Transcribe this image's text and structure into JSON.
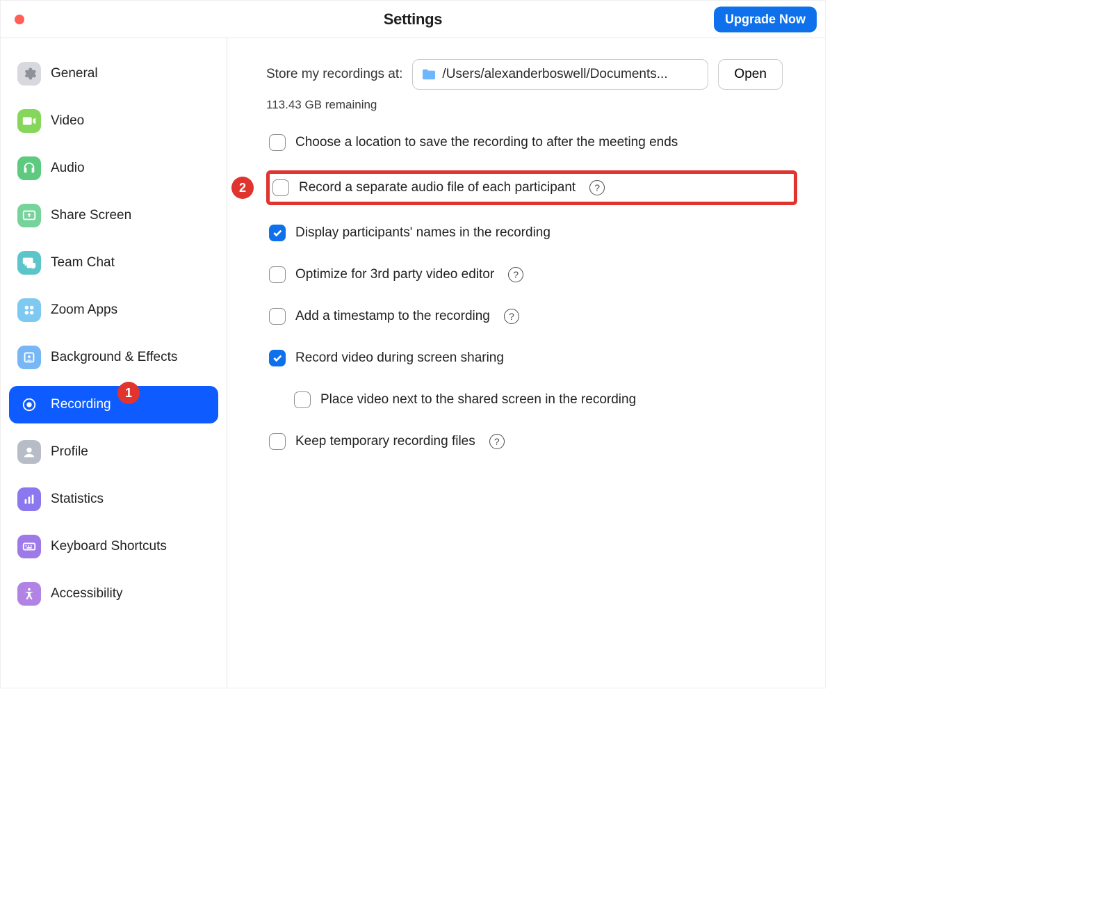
{
  "window": {
    "title": "Settings",
    "upgrade_label": "Upgrade Now"
  },
  "sidebar": {
    "items": [
      {
        "label": "General",
        "icon": "gear-icon",
        "color": "#d7d9de",
        "fg": "#8e9199"
      },
      {
        "label": "Video",
        "icon": "video-icon",
        "color": "#86d65b",
        "fg": "#ffffff"
      },
      {
        "label": "Audio",
        "icon": "headphones-icon",
        "color": "#5eca7f",
        "fg": "#ffffff"
      },
      {
        "label": "Share Screen",
        "icon": "share-screen-icon",
        "color": "#76d39a",
        "fg": "#ffffff"
      },
      {
        "label": "Team Chat",
        "icon": "chat-icon",
        "color": "#5cc5c9",
        "fg": "#ffffff"
      },
      {
        "label": "Zoom Apps",
        "icon": "apps-icon",
        "color": "#7ec9f2",
        "fg": "#ffffff"
      },
      {
        "label": "Background & Effects",
        "icon": "background-icon",
        "color": "#78b7f6",
        "fg": "#ffffff"
      },
      {
        "label": "Recording",
        "icon": "record-icon",
        "color": "#ffffff",
        "fg": "#0e5cff",
        "active": true
      },
      {
        "label": "Profile",
        "icon": "profile-icon",
        "color": "#b7bcc7",
        "fg": "#ffffff"
      },
      {
        "label": "Statistics",
        "icon": "stats-icon",
        "color": "#8b78ef",
        "fg": "#ffffff"
      },
      {
        "label": "Keyboard Shortcuts",
        "icon": "keyboard-icon",
        "color": "#9e7ae9",
        "fg": "#ffffff"
      },
      {
        "label": "Accessibility",
        "icon": "accessibility-icon",
        "color": "#b083e5",
        "fg": "#ffffff"
      }
    ]
  },
  "recording": {
    "store_label": "Store my recordings at:",
    "path": "/Users/alexanderboswell/Documents...",
    "open_label": "Open",
    "remaining": "113.43 GB remaining",
    "options": [
      {
        "label": "Choose a location to save the recording to after the meeting ends",
        "checked": false,
        "help": false
      },
      {
        "label": "Record a separate audio file of each participant",
        "checked": false,
        "help": true,
        "highlight": true
      },
      {
        "label": "Display participants' names in the recording",
        "checked": true,
        "help": false
      },
      {
        "label": "Optimize for 3rd party video editor",
        "checked": false,
        "help": true
      },
      {
        "label": "Add a timestamp to the recording",
        "checked": false,
        "help": true
      },
      {
        "label": "Record video during screen sharing",
        "checked": true,
        "help": false
      },
      {
        "label": "Place video next to the shared screen in the recording",
        "checked": false,
        "help": false,
        "nested": true
      },
      {
        "label": "Keep temporary recording files",
        "checked": false,
        "help": true
      }
    ]
  },
  "callouts": {
    "one": "1",
    "two": "2"
  },
  "help_glyph": "?"
}
